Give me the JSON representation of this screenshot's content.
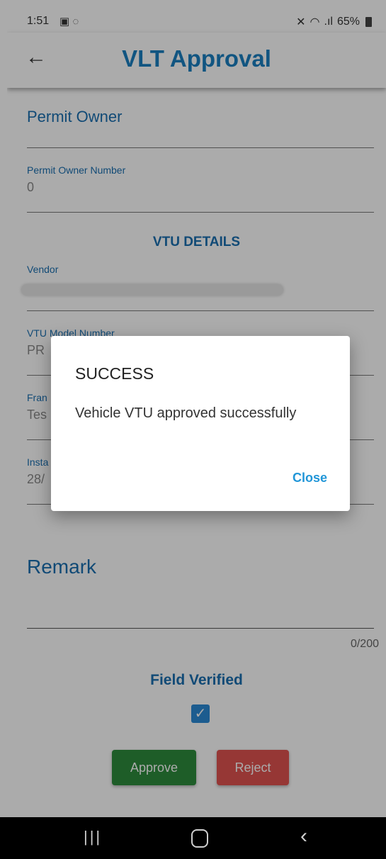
{
  "status_bar": {
    "time": "1:51",
    "left_icons": [
      "gallery-icon",
      "whatsapp-icon"
    ],
    "battery": "65%",
    "right_icons": [
      "mute-icon",
      "wifi-icon",
      "signal-icon",
      "battery-icon"
    ]
  },
  "app_bar": {
    "title": "VLT Approval",
    "back_icon": "back-arrow-icon"
  },
  "form": {
    "permit_owner_label": "Permit Owner",
    "permit_owner_number_label": "Permit Owner Number",
    "permit_owner_number_value": "0",
    "vtu_section_title": "VTU DETAILS",
    "vendor_label": "Vendor",
    "vtu_model_label": "VTU Model Number",
    "vtu_model_value_partial": "PR",
    "franchise_label_partial": "Fran",
    "franchise_value_partial": "Tes",
    "install_label_partial": "Insta",
    "install_value_partial": "28/",
    "remark_label": "Remark",
    "remark_counter": "0/200",
    "field_verified_label": "Field Verified",
    "field_verified_checked": true,
    "approve_label": "Approve",
    "reject_label": "Reject"
  },
  "dialog": {
    "title": "SUCCESS",
    "message": "Vehicle VTU approved successfully",
    "close_label": "Close"
  },
  "nav_bar": {
    "icons": [
      "recents-icon",
      "home-icon",
      "back-icon"
    ]
  },
  "colors": {
    "accent_blue": "#1a6fb0",
    "approve_green": "#2e8b3d",
    "reject_red": "#e0534f",
    "dialog_button": "#2196d8"
  }
}
